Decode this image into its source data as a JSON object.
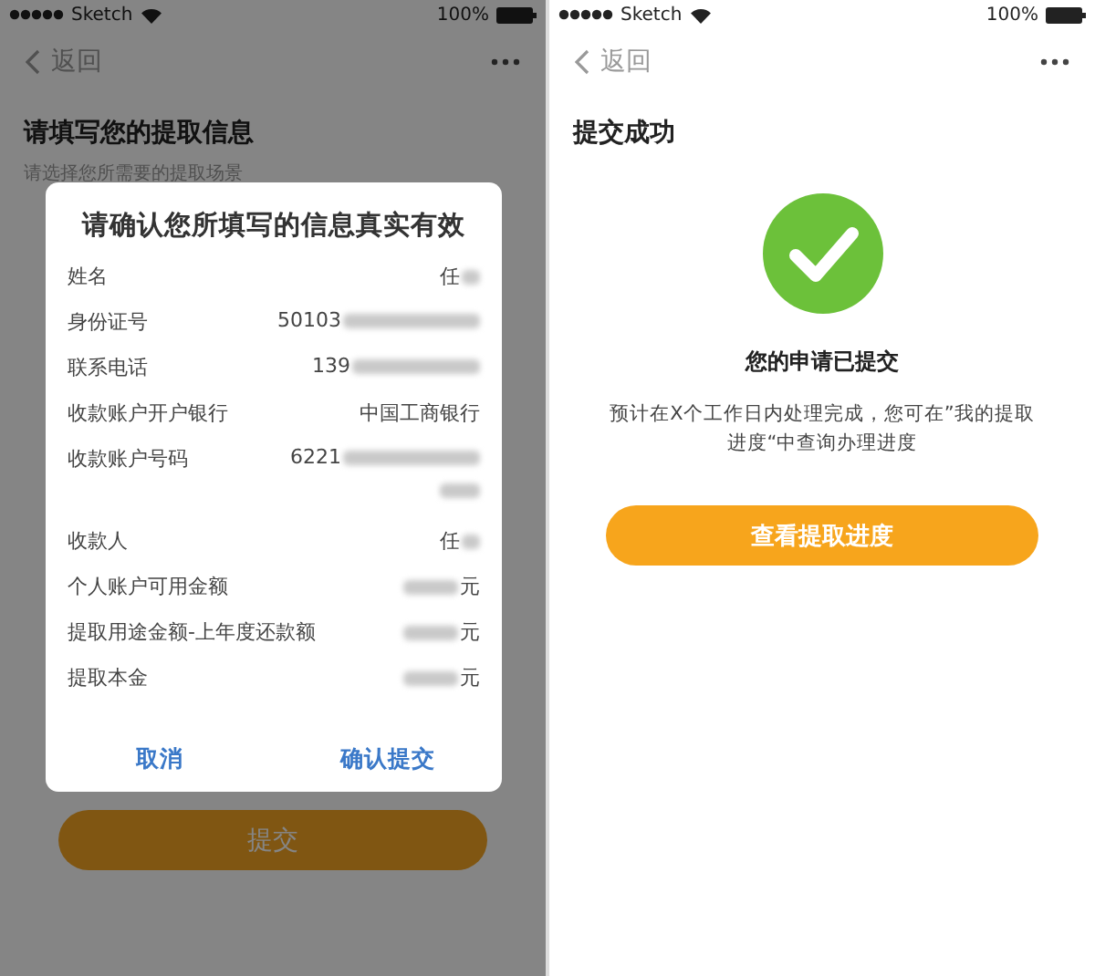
{
  "left_screen": {
    "status_bar": {
      "carrier": "Sketch",
      "battery": "100%"
    },
    "nav": {
      "back": "返回"
    },
    "title": "请填写您的提取信息",
    "subtitle": "请选择您所需要的提取场景",
    "submit_button": {
      "label": "提交"
    },
    "dialog": {
      "title": "请确认您所填写的信息真实有效",
      "rows": [
        {
          "label": "姓名",
          "value": "任",
          "redacted": true
        },
        {
          "label": "身份证号",
          "value": "50103",
          "redacted": true
        },
        {
          "label": "联系电话",
          "value": "139",
          "redacted": true
        },
        {
          "label": "收款账户开户银行",
          "value": "中国工商银行",
          "redacted": false
        },
        {
          "label": "收款账户号码",
          "value": "6221",
          "redacted": true,
          "wrap": true
        },
        {
          "label": "收款人",
          "value": "任",
          "redacted": true
        },
        {
          "label": "个人账户可用金额",
          "unit": "元",
          "redacted": true
        },
        {
          "label": "提取用途金额-上年度还款额",
          "unit": "元",
          "redacted": true
        },
        {
          "label": "提取本金",
          "unit": "元",
          "redacted": true
        }
      ],
      "buttons": [
        {
          "label": "取消"
        },
        {
          "label": "确认提交"
        }
      ]
    }
  },
  "right_screen": {
    "status_bar": {
      "carrier": "Sketch",
      "battery": "100%"
    },
    "nav": {
      "back": "返回"
    },
    "title": "提交成功",
    "heading": "您的申请已提交",
    "description": "预计在X个工作日内处理完成，您可在”我的提取进度“中查询办理进度",
    "button": {
      "label": "查看提取进度"
    }
  }
}
